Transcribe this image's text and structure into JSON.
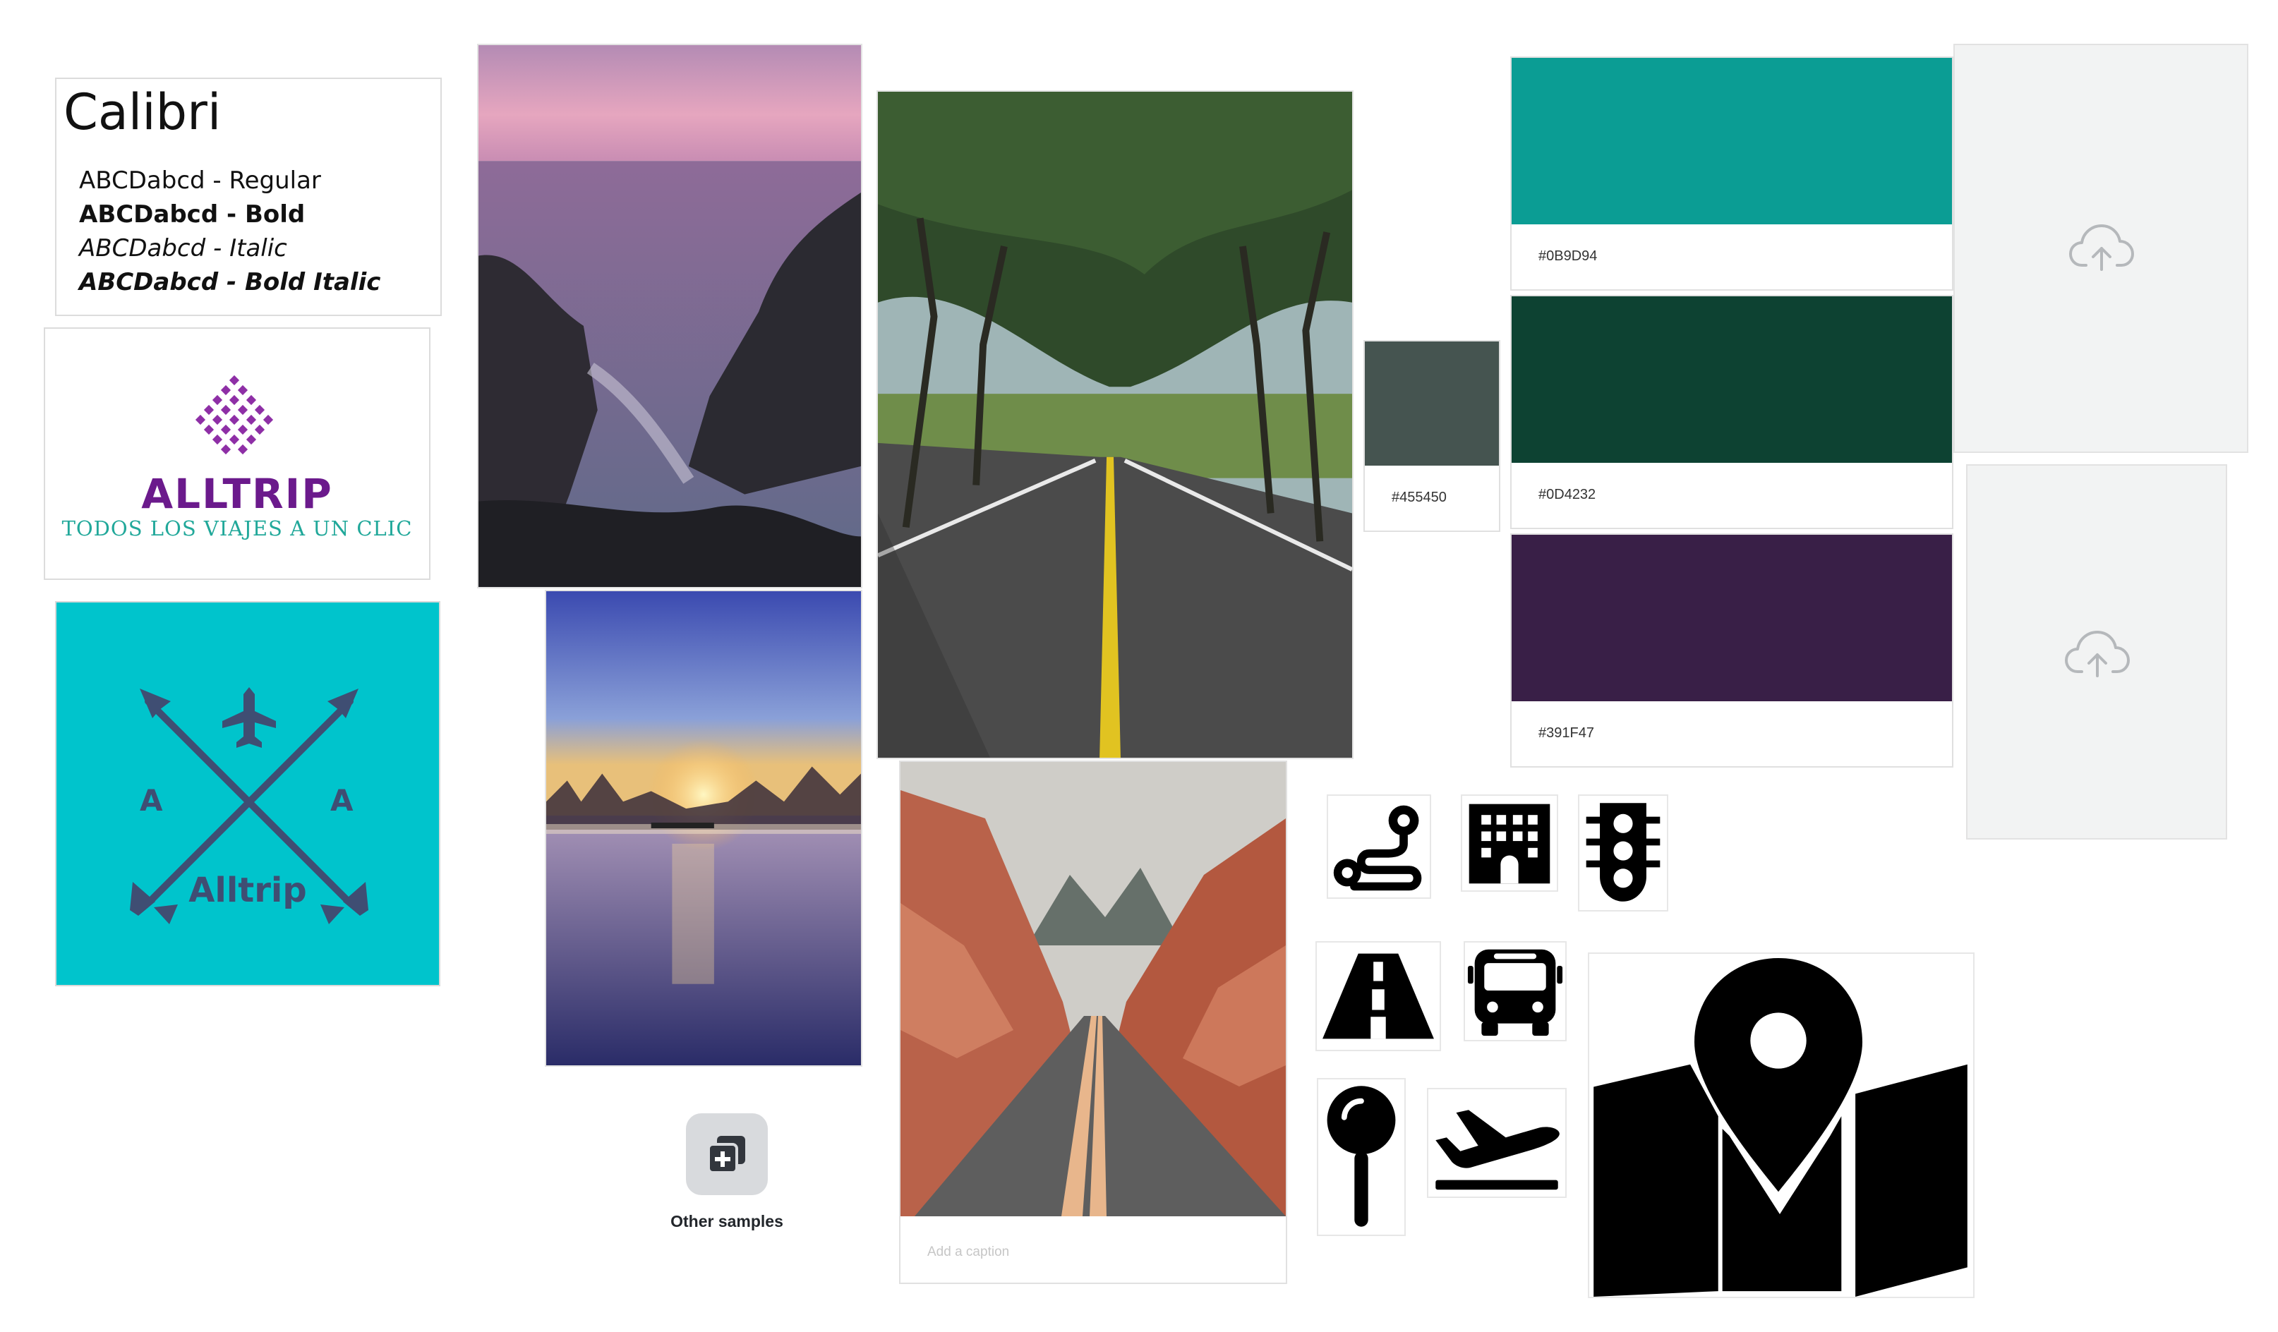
{
  "font_card": {
    "title": "Calibri",
    "regular": "ABCDabcd - Regular",
    "bold": "ABCDabcd - Bold",
    "italic": "ABCDabcd - Italic",
    "bold_italic": "ABCDabcd - Bold Italic"
  },
  "logo_card": {
    "name": "ALLTRIP",
    "tagline": "TODOS LOS VIAJES A UN CLIC",
    "brand_purple": "#6B1A8C",
    "brand_teal": "#21A89A"
  },
  "emblem": {
    "left_letter": "A",
    "right_letter": "A",
    "wordmark": "Alltrip",
    "background": "#00C4CC",
    "foreground": "#3F4E73"
  },
  "swatches": {
    "small": {
      "hex": "#455450",
      "color": "#455450"
    },
    "teal": {
      "hex": "#0B9D94",
      "color": "#0B9D94"
    },
    "green": {
      "hex": "#0D4232",
      "color": "#0D4232"
    },
    "purple": {
      "hex": "#391F47",
      "color": "#391F47"
    }
  },
  "photos": {
    "names": [
      "sunset-sea-rocks-photo",
      "lake-sunrise-photo",
      "tree-road-photo",
      "canyon-road-photo"
    ]
  },
  "canyon_caption": {
    "placeholder": "Add a caption"
  },
  "other_samples": {
    "label": "Other samples",
    "icon": "add-to-collection-icon"
  },
  "upload_slots": [
    {
      "icon": "cloud-upload-icon"
    },
    {
      "icon": "cloud-upload-icon"
    }
  ],
  "icons": [
    "route-icon",
    "hotel-building-icon",
    "traffic-light-icon",
    "highway-icon",
    "bus-icon",
    "pin-icon",
    "plane-departure-icon",
    "map-location-icon"
  ]
}
